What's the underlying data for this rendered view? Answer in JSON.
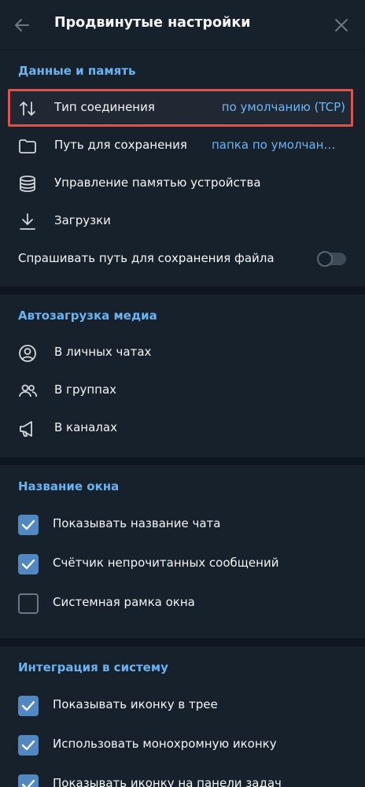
{
  "header": {
    "title": "Продвинутые настройки",
    "back_icon": "arrow-left-icon",
    "close_icon": "close-icon"
  },
  "data_memory": {
    "title": "Данные и память",
    "items": [
      {
        "icon": "arrows-updown-icon",
        "label": "Тип соединения",
        "value": "по умолчанию (TCP)"
      },
      {
        "icon": "folder-icon",
        "label": "Путь для сохранения",
        "value": "папка по умолчанию"
      },
      {
        "icon": "database-icon",
        "label": "Управление памятью устройства",
        "value": ""
      },
      {
        "icon": "download-icon",
        "label": "Загрузки",
        "value": ""
      }
    ],
    "ask_path": {
      "label": "Спрашивать путь для сохранения файла",
      "enabled": false
    }
  },
  "autodownload": {
    "title": "Автозагрузка медиа",
    "items": [
      {
        "icon": "user-icon",
        "label": "В личных чатах"
      },
      {
        "icon": "group-icon",
        "label": "В группах"
      },
      {
        "icon": "megaphone-icon",
        "label": "В каналах"
      }
    ]
  },
  "window_title": {
    "title": "Название окна",
    "items": [
      {
        "label": "Показывать название чата",
        "checked": true
      },
      {
        "label": "Счётчик непрочитанных сообщений",
        "checked": true
      },
      {
        "label": "Системная рамка окна",
        "checked": false
      }
    ]
  },
  "integration": {
    "title": "Интеграция в систему",
    "items": [
      {
        "label": "Показывать иконку в трее",
        "checked": true
      },
      {
        "label": "Использовать монохромную иконку",
        "checked": true
      },
      {
        "label": "Показывать иконку на панели задач",
        "checked": true
      }
    ]
  },
  "colors": {
    "background": "#17212b",
    "separator": "#0e1621",
    "accent": "#6ab3f3",
    "checkbox": "#5288c1",
    "highlight": "#d9534f"
  }
}
